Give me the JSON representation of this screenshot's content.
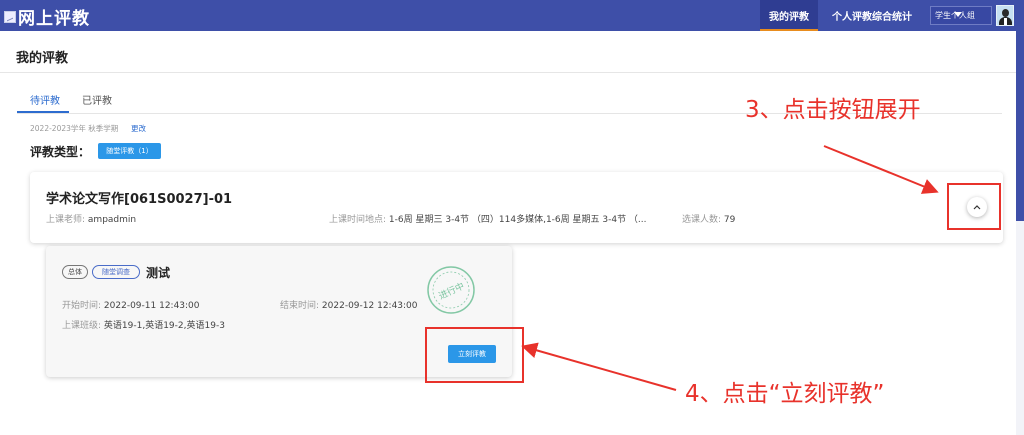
{
  "app": {
    "title": "网上评教"
  },
  "nav": {
    "my_eval": "我的评教",
    "stats": "个人评教综合统计",
    "user": "学生个人组"
  },
  "page": {
    "title": "我的评教"
  },
  "tabs": [
    {
      "label": "待评教",
      "active": true
    },
    {
      "label": "已评教",
      "active": false
    }
  ],
  "term": {
    "text": "2022-2023学年 秋季学期",
    "change": "更改"
  },
  "eval_type": {
    "label": "评教类型：",
    "tag": "随堂评教（1）"
  },
  "course": {
    "name": "学术论文写作[061S0027]-01",
    "teacher_label": "上课老师:",
    "teacher": "ampadmin",
    "time_label": "上课时间地点:",
    "time": "1-6周 星期三 3-4节 （四）114多媒体,1-6周 星期五 3-4节 （...",
    "count_label": "选课人数:",
    "count": "79"
  },
  "evaluation": {
    "tags": [
      "总体",
      "随堂调查"
    ],
    "title": "测试",
    "start_label": "开始时间:",
    "start": "2022-09-11 12:43:00",
    "end_label": "结束时间:",
    "end": "2022-09-12 12:43:00",
    "class_label": "上课班级:",
    "classes": "英语19-1,英语19-2,英语19-3",
    "stamp": "进行中",
    "button": "立刻评教"
  },
  "annotations": {
    "step3": "3、点击按钮展开",
    "step4": "4、点击“立刻评教”"
  },
  "colors": {
    "header": "#3e4fa8",
    "accent": "#2b97e8",
    "annotation": "#e8322b",
    "stamp": "#5cb88a"
  },
  "icons": {
    "expand": "chevron-up-icon",
    "user_menu": "caret-down-icon",
    "logo": "broken-image-icon"
  }
}
